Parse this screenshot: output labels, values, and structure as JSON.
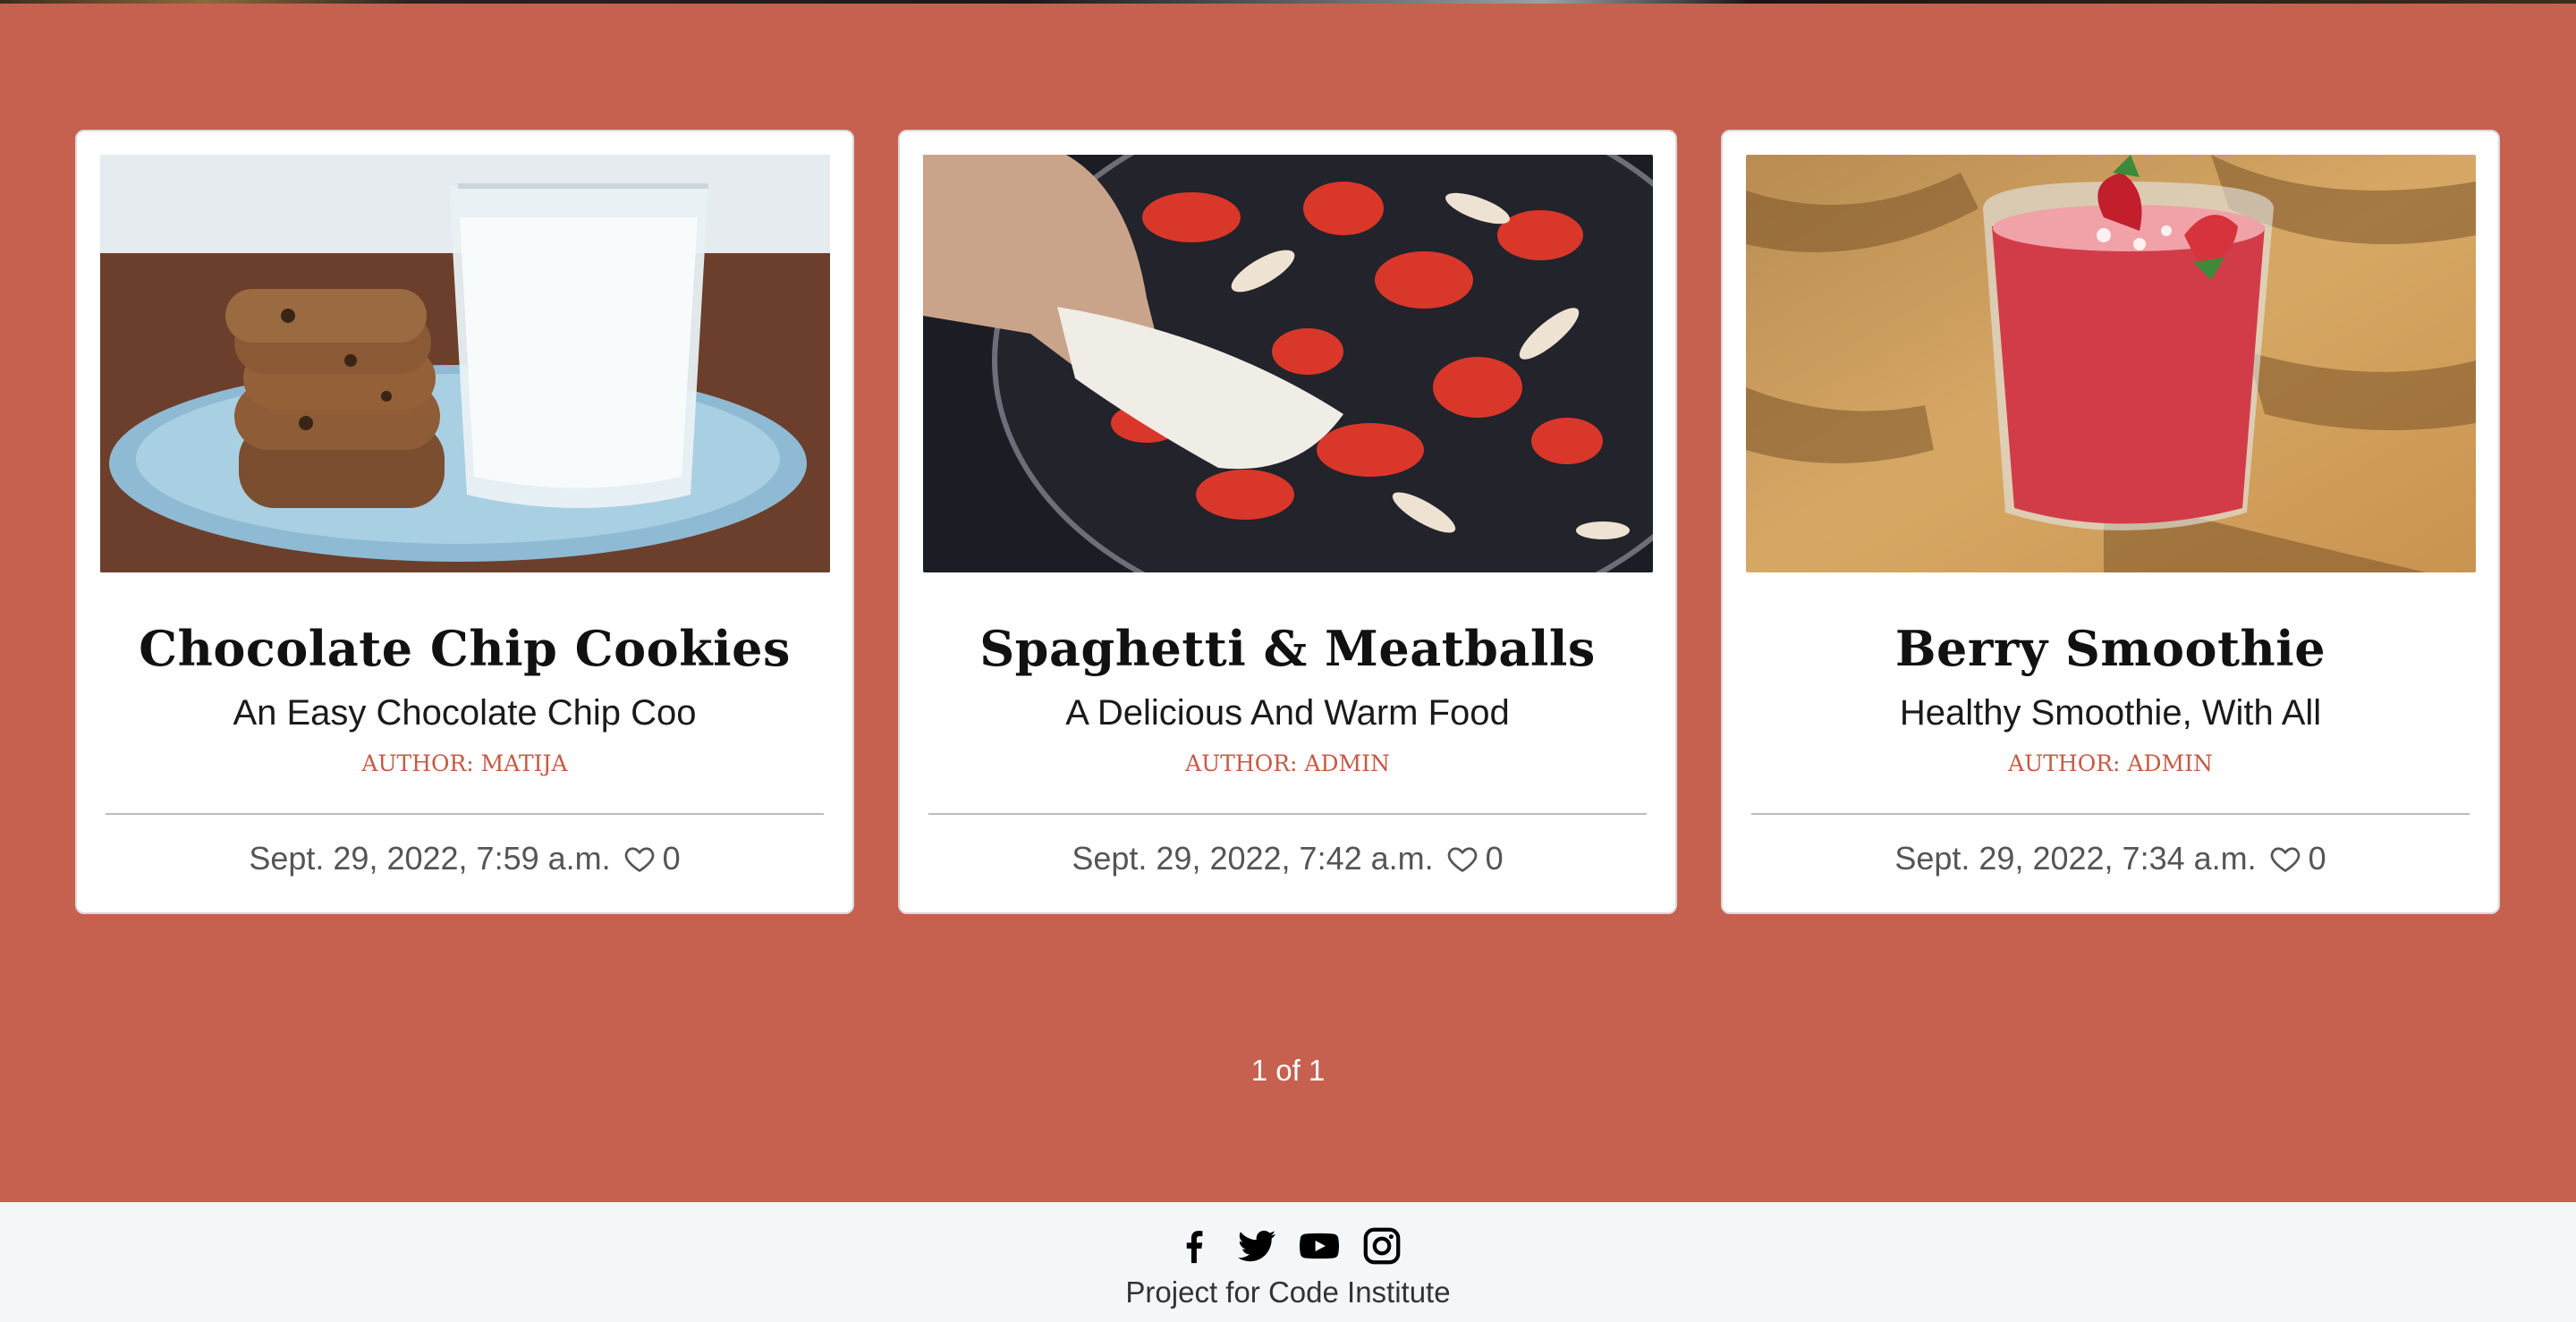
{
  "cards": [
    {
      "image_alt": "cookies-and-milk",
      "title": "Chocolate Chip Cookies",
      "subtitle": "An Easy Chocolate Chip Coo",
      "author": "Author: matija",
      "date": "Sept. 29, 2022, 7:59 a.m.",
      "likes": "0"
    },
    {
      "image_alt": "tomatoes-and-onions-in-pan",
      "title": "Spaghetti & Meatballs",
      "subtitle": "A Delicious And Warm Food",
      "author": "Author: admin",
      "date": "Sept. 29, 2022, 7:42 a.m.",
      "likes": "0"
    },
    {
      "image_alt": "berry-smoothie-glass",
      "title": "Berry Smoothie",
      "subtitle": "Healthy Smoothie, With All",
      "author": "Author: admin",
      "date": "Sept. 29, 2022, 7:34 a.m.",
      "likes": "0"
    }
  ],
  "pagination": {
    "text": "1 of 1"
  },
  "footer": {
    "social_icons": [
      "facebook-icon",
      "twitter-icon",
      "youtube-icon",
      "instagram-icon"
    ],
    "text": "Project for Code Institute"
  },
  "colors": {
    "background": "#c66150",
    "card": "#ffffff",
    "author": "#c65a44",
    "footer_bg": "#f5f6f8"
  }
}
